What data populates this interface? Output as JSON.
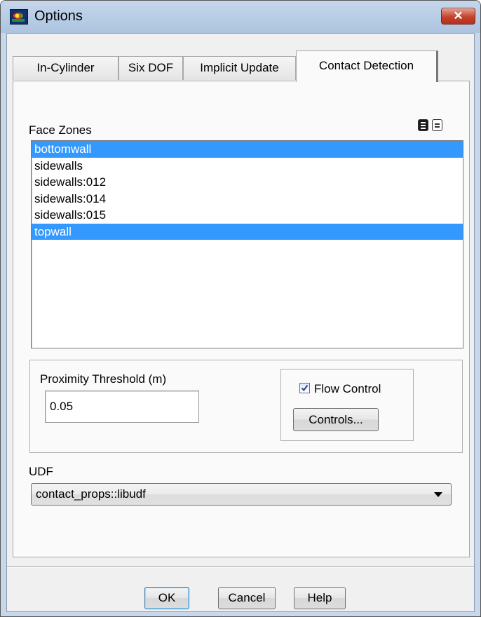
{
  "window": {
    "title": "Options",
    "close_icon": "✕"
  },
  "tabs": [
    {
      "label": "In-Cylinder",
      "active": false
    },
    {
      "label": "Six DOF",
      "active": false
    },
    {
      "label": "Implicit Update",
      "active": false
    },
    {
      "label": "Contact Detection",
      "active": true
    }
  ],
  "face_zones": {
    "label": "Face Zones",
    "select_all_icon": "list-select-all-icon",
    "deselect_all_icon": "list-deselect-all-icon",
    "items": [
      {
        "label": "bottomwall",
        "selected": true
      },
      {
        "label": "sidewalls",
        "selected": false
      },
      {
        "label": "sidewalls:012",
        "selected": false
      },
      {
        "label": "sidewalls:014",
        "selected": false
      },
      {
        "label": "sidewalls:015",
        "selected": false
      },
      {
        "label": "topwall",
        "selected": true
      }
    ]
  },
  "proximity": {
    "label": "Proximity Threshold (m)",
    "value": "0.05"
  },
  "flow_control": {
    "label": "Flow Control",
    "checked": true,
    "controls_button": "Controls..."
  },
  "udf": {
    "label": "UDF",
    "value": "contact_props::libudf"
  },
  "buttons": {
    "ok": "OK",
    "cancel": "Cancel",
    "help": "Help"
  },
  "colors": {
    "selection": "#3399ff",
    "close_button": "#c6422c",
    "title_bar": "#b9cde6"
  }
}
